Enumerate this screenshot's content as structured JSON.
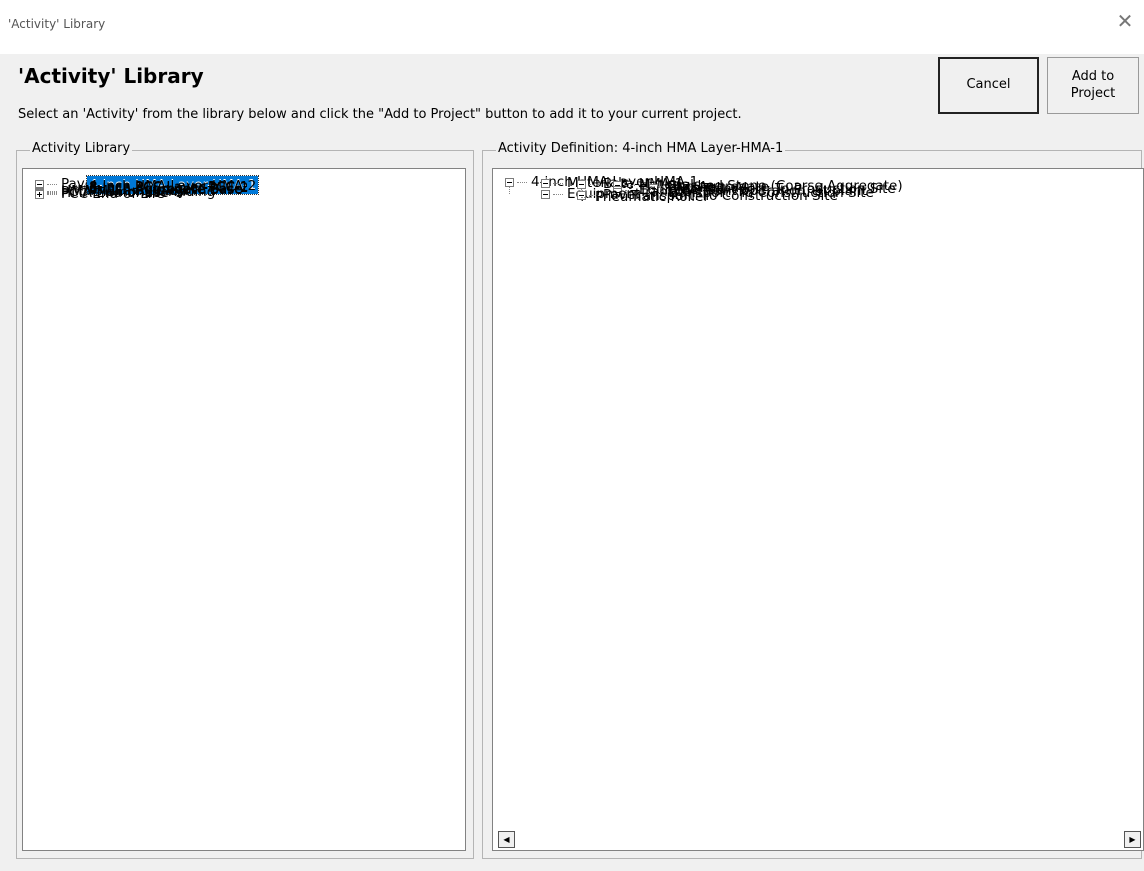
{
  "window": {
    "title": "'Activity' Library",
    "close_icon": "close-icon"
  },
  "header": {
    "heading": "'Activity' Library",
    "instruction": "Select an 'Activity' from the library below and click the \"Add to Project\" button to add it to your current project."
  },
  "buttons": {
    "cancel": "Cancel",
    "add_to_project": "Add to\nProject"
  },
  "library": {
    "legend": "Activity Library",
    "tree": [
      {
        "label": "Pavement Layers",
        "expanded": true
      },
      {
        "label": "4-inch HMA Layer-HMA-1",
        "selected": true
      },
      {
        "label": "4-inch HMA Layer-HMA-2"
      },
      {
        "label": "8-inch PCC Layer-PCC-1"
      },
      {
        "label": "8-inch PCC Layer-PCC-2"
      },
      {
        "label": "6-inch Aggregate Base"
      },
      {
        "label": "6-inch Aggregate Base"
      },
      {
        "label": "HMA Mill and Inlay",
        "expanded": false
      },
      {
        "label": "PCC Diamond Grinding",
        "expanded": false
      },
      {
        "label": "HMA End-of-Life",
        "expanded": false
      },
      {
        "label": "PCC End-of-Life",
        "expanded": false
      }
    ]
  },
  "definition": {
    "legend": "Activity Definition: 4-inch HMA Layer-HMA-1",
    "tree": [
      {
        "label": "4-inch HMA Layer-HMA-1",
        "expanded": true
      },
      {
        "label": "Materials",
        "expanded": true
      },
      {
        "label": "Beta-HMA-1",
        "expanded": true
      },
      {
        "label": "Materials",
        "expanded": true
      },
      {
        "label": "Crushed Stone (Coarse Aggregate)"
      },
      {
        "label": "Fine Aggregate"
      },
      {
        "label": "Asphalt, AI",
        "expanded": true
      },
      {
        "label": "Transport: To Production Site"
      },
      {
        "label": "Equipment",
        "expanded": true
      },
      {
        "label": "HMA plant operation, at plant"
      },
      {
        "label": "Transport",
        "expanded": true
      },
      {
        "label": "Transport: To Construction Site"
      },
      {
        "label": "Equipment",
        "expanded": true
      },
      {
        "label": "Paver",
        "expanded": true
      },
      {
        "label": "Transport: To Construction Site"
      },
      {
        "label": "Pneumatic Roller"
      }
    ],
    "scrollbar": {
      "left_icon": "scroll-left-icon",
      "right_icon": "scroll-right-icon"
    }
  }
}
